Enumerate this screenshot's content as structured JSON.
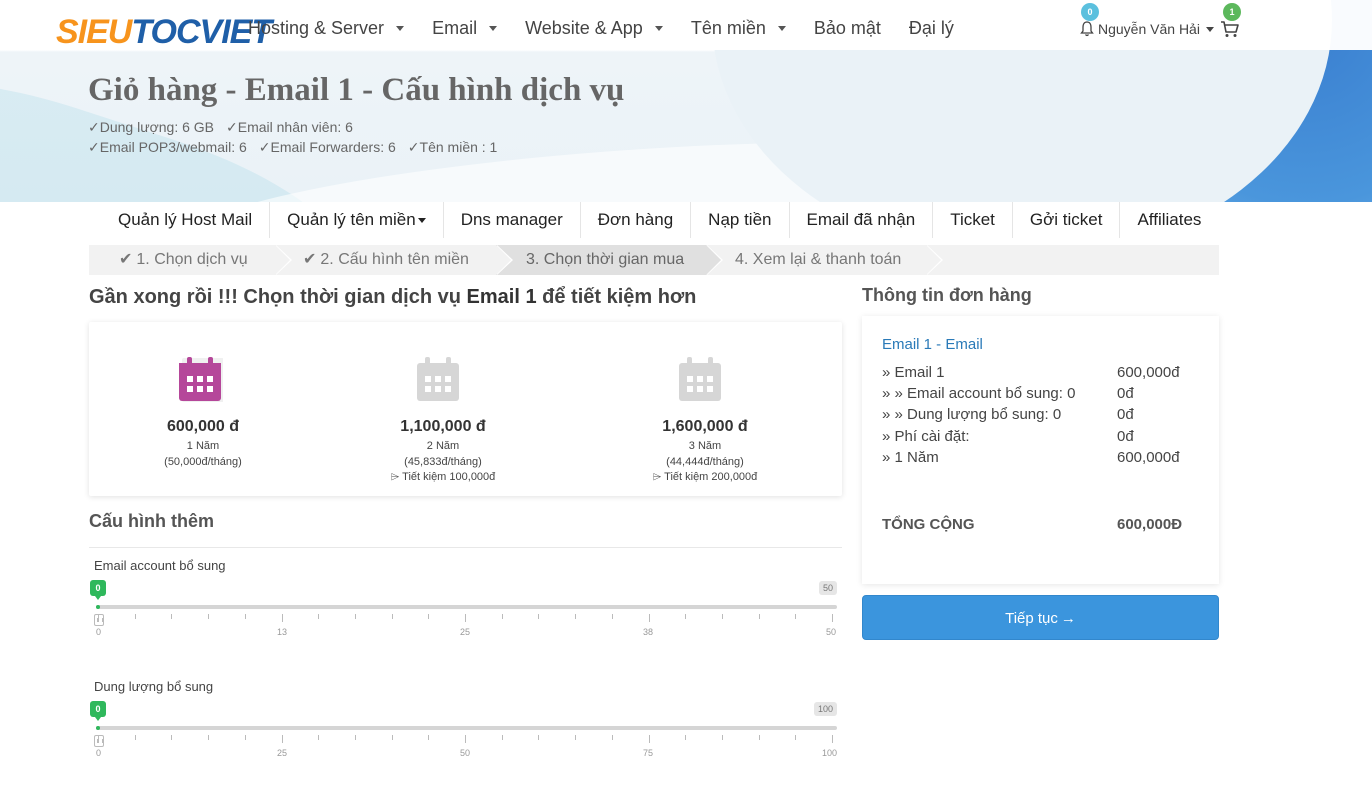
{
  "brand": {
    "logo_part1": "SIEU",
    "logo_part2": "TOC",
    "logo_part3": "VIET"
  },
  "topnav": [
    {
      "label": "Hosting & Server",
      "dropdown": true
    },
    {
      "label": "Email",
      "dropdown": true
    },
    {
      "label": "Website & App",
      "dropdown": true
    },
    {
      "label": "Tên miền",
      "dropdown": true
    },
    {
      "label": "Bảo mật",
      "dropdown": false
    },
    {
      "label": "Đại lý",
      "dropdown": false
    }
  ],
  "user": {
    "notifications": "0",
    "name": "Nguyễn Văn Hải",
    "cart_count": "1"
  },
  "page": {
    "title": "Giỏ hàng - Email 1 - Cấu hình dịch vụ",
    "features_line1": [
      "✓Dung lượng: 6 GB",
      "✓Email nhân viên: 6"
    ],
    "features_line2": [
      "✓Email POP3/webmail: 6",
      "✓Email Forwarders: 6",
      "✓Tên miền : 1"
    ]
  },
  "subnav": [
    {
      "label": "Quản lý Host Mail",
      "dropdown": false
    },
    {
      "label": "Quản lý tên miền",
      "dropdown": true
    },
    {
      "label": "Dns manager",
      "dropdown": false
    },
    {
      "label": "Đơn hàng",
      "dropdown": false
    },
    {
      "label": "Nạp tiền",
      "dropdown": false
    },
    {
      "label": "Email đã nhận",
      "dropdown": false
    },
    {
      "label": "Ticket",
      "dropdown": false
    },
    {
      "label": "Gởi ticket",
      "dropdown": false
    },
    {
      "label": "Affiliates",
      "dropdown": false
    }
  ],
  "steps": [
    {
      "label": "1. Chọn dịch vụ",
      "done": true,
      "active": false
    },
    {
      "label": "2. Cấu hình tên miền",
      "done": true,
      "active": false
    },
    {
      "label": "3. Chọn thời gian mua",
      "done": false,
      "active": true
    },
    {
      "label": "4. Xem lại & thanh toán",
      "done": false,
      "active": false
    }
  ],
  "heading": {
    "prefix": "Gần xong rồi !!! Chọn thời gian dịch vụ ",
    "product": "Email 1",
    "suffix": " để tiết kiệm hơn"
  },
  "plans": [
    {
      "price": "600,000 đ",
      "term": "1 Năm",
      "monthly": "(50,000đ/tháng)",
      "save": "",
      "selected": true
    },
    {
      "price": "1,100,000 đ",
      "term": "2 Năm",
      "monthly": "(45,833đ/tháng)",
      "save": "Tiết kiệm 100,000đ",
      "selected": false
    },
    {
      "price": "1,600,000 đ",
      "term": "3 Năm",
      "monthly": "(44,444đ/tháng)",
      "save": "Tiết kiệm 200,000đ",
      "selected": false
    }
  ],
  "colors": {
    "selected_calendar": "#b5479a",
    "inactive_calendar": "#d6d6d6",
    "accent": "#3b95dd",
    "slider_green": "#2fb85c"
  },
  "config": {
    "title": "Cấu hình thêm",
    "sliders": [
      {
        "label": "Email account bổ sung",
        "value": "0",
        "max": "50",
        "ticklabels": [
          "0",
          "13",
          "25",
          "38",
          "50"
        ]
      },
      {
        "label": "Dung lượng bổ sung",
        "value": "0",
        "max": "100",
        "ticklabels": [
          "0",
          "25",
          "50",
          "75",
          "100"
        ]
      }
    ]
  },
  "order": {
    "title": "Thông tin đơn hàng",
    "name": "Email 1 - Email",
    "lines": [
      {
        "label": "» Email 1",
        "value": "600,000đ"
      },
      {
        "label": "»  » Email account bổ sung: 0",
        "value": "0đ"
      },
      {
        "label": "»  » Dung lượng bổ sung: 0",
        "value": "0đ"
      },
      {
        "label": "» Phí cài đặt:",
        "value": "0đ"
      },
      {
        "label": "» 1 Năm",
        "value": "600,000đ"
      }
    ],
    "total_label": "TỔNG CỘNG",
    "total_value": "600,000Đ",
    "continue_label": "Tiếp tục"
  }
}
